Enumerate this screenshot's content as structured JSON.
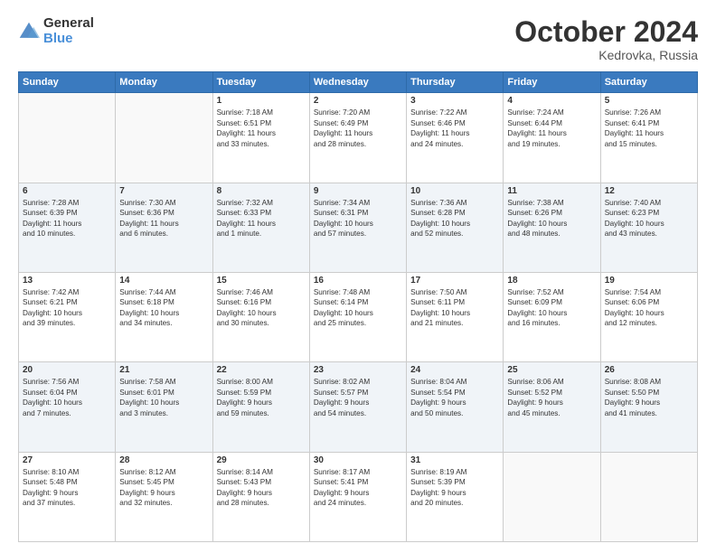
{
  "logo": {
    "line1": "General",
    "line2": "Blue"
  },
  "title": "October 2024",
  "subtitle": "Kedrovka, Russia",
  "days_header": [
    "Sunday",
    "Monday",
    "Tuesday",
    "Wednesday",
    "Thursday",
    "Friday",
    "Saturday"
  ],
  "weeks": [
    [
      {
        "day": "",
        "info": ""
      },
      {
        "day": "",
        "info": ""
      },
      {
        "day": "1",
        "info": "Sunrise: 7:18 AM\nSunset: 6:51 PM\nDaylight: 11 hours\nand 33 minutes."
      },
      {
        "day": "2",
        "info": "Sunrise: 7:20 AM\nSunset: 6:49 PM\nDaylight: 11 hours\nand 28 minutes."
      },
      {
        "day": "3",
        "info": "Sunrise: 7:22 AM\nSunset: 6:46 PM\nDaylight: 11 hours\nand 24 minutes."
      },
      {
        "day": "4",
        "info": "Sunrise: 7:24 AM\nSunset: 6:44 PM\nDaylight: 11 hours\nand 19 minutes."
      },
      {
        "day": "5",
        "info": "Sunrise: 7:26 AM\nSunset: 6:41 PM\nDaylight: 11 hours\nand 15 minutes."
      }
    ],
    [
      {
        "day": "6",
        "info": "Sunrise: 7:28 AM\nSunset: 6:39 PM\nDaylight: 11 hours\nand 10 minutes."
      },
      {
        "day": "7",
        "info": "Sunrise: 7:30 AM\nSunset: 6:36 PM\nDaylight: 11 hours\nand 6 minutes."
      },
      {
        "day": "8",
        "info": "Sunrise: 7:32 AM\nSunset: 6:33 PM\nDaylight: 11 hours\nand 1 minute."
      },
      {
        "day": "9",
        "info": "Sunrise: 7:34 AM\nSunset: 6:31 PM\nDaylight: 10 hours\nand 57 minutes."
      },
      {
        "day": "10",
        "info": "Sunrise: 7:36 AM\nSunset: 6:28 PM\nDaylight: 10 hours\nand 52 minutes."
      },
      {
        "day": "11",
        "info": "Sunrise: 7:38 AM\nSunset: 6:26 PM\nDaylight: 10 hours\nand 48 minutes."
      },
      {
        "day": "12",
        "info": "Sunrise: 7:40 AM\nSunset: 6:23 PM\nDaylight: 10 hours\nand 43 minutes."
      }
    ],
    [
      {
        "day": "13",
        "info": "Sunrise: 7:42 AM\nSunset: 6:21 PM\nDaylight: 10 hours\nand 39 minutes."
      },
      {
        "day": "14",
        "info": "Sunrise: 7:44 AM\nSunset: 6:18 PM\nDaylight: 10 hours\nand 34 minutes."
      },
      {
        "day": "15",
        "info": "Sunrise: 7:46 AM\nSunset: 6:16 PM\nDaylight: 10 hours\nand 30 minutes."
      },
      {
        "day": "16",
        "info": "Sunrise: 7:48 AM\nSunset: 6:14 PM\nDaylight: 10 hours\nand 25 minutes."
      },
      {
        "day": "17",
        "info": "Sunrise: 7:50 AM\nSunset: 6:11 PM\nDaylight: 10 hours\nand 21 minutes."
      },
      {
        "day": "18",
        "info": "Sunrise: 7:52 AM\nSunset: 6:09 PM\nDaylight: 10 hours\nand 16 minutes."
      },
      {
        "day": "19",
        "info": "Sunrise: 7:54 AM\nSunset: 6:06 PM\nDaylight: 10 hours\nand 12 minutes."
      }
    ],
    [
      {
        "day": "20",
        "info": "Sunrise: 7:56 AM\nSunset: 6:04 PM\nDaylight: 10 hours\nand 7 minutes."
      },
      {
        "day": "21",
        "info": "Sunrise: 7:58 AM\nSunset: 6:01 PM\nDaylight: 10 hours\nand 3 minutes."
      },
      {
        "day": "22",
        "info": "Sunrise: 8:00 AM\nSunset: 5:59 PM\nDaylight: 9 hours\nand 59 minutes."
      },
      {
        "day": "23",
        "info": "Sunrise: 8:02 AM\nSunset: 5:57 PM\nDaylight: 9 hours\nand 54 minutes."
      },
      {
        "day": "24",
        "info": "Sunrise: 8:04 AM\nSunset: 5:54 PM\nDaylight: 9 hours\nand 50 minutes."
      },
      {
        "day": "25",
        "info": "Sunrise: 8:06 AM\nSunset: 5:52 PM\nDaylight: 9 hours\nand 45 minutes."
      },
      {
        "day": "26",
        "info": "Sunrise: 8:08 AM\nSunset: 5:50 PM\nDaylight: 9 hours\nand 41 minutes."
      }
    ],
    [
      {
        "day": "27",
        "info": "Sunrise: 8:10 AM\nSunset: 5:48 PM\nDaylight: 9 hours\nand 37 minutes."
      },
      {
        "day": "28",
        "info": "Sunrise: 8:12 AM\nSunset: 5:45 PM\nDaylight: 9 hours\nand 32 minutes."
      },
      {
        "day": "29",
        "info": "Sunrise: 8:14 AM\nSunset: 5:43 PM\nDaylight: 9 hours\nand 28 minutes."
      },
      {
        "day": "30",
        "info": "Sunrise: 8:17 AM\nSunset: 5:41 PM\nDaylight: 9 hours\nand 24 minutes."
      },
      {
        "day": "31",
        "info": "Sunrise: 8:19 AM\nSunset: 5:39 PM\nDaylight: 9 hours\nand 20 minutes."
      },
      {
        "day": "",
        "info": ""
      },
      {
        "day": "",
        "info": ""
      }
    ]
  ]
}
